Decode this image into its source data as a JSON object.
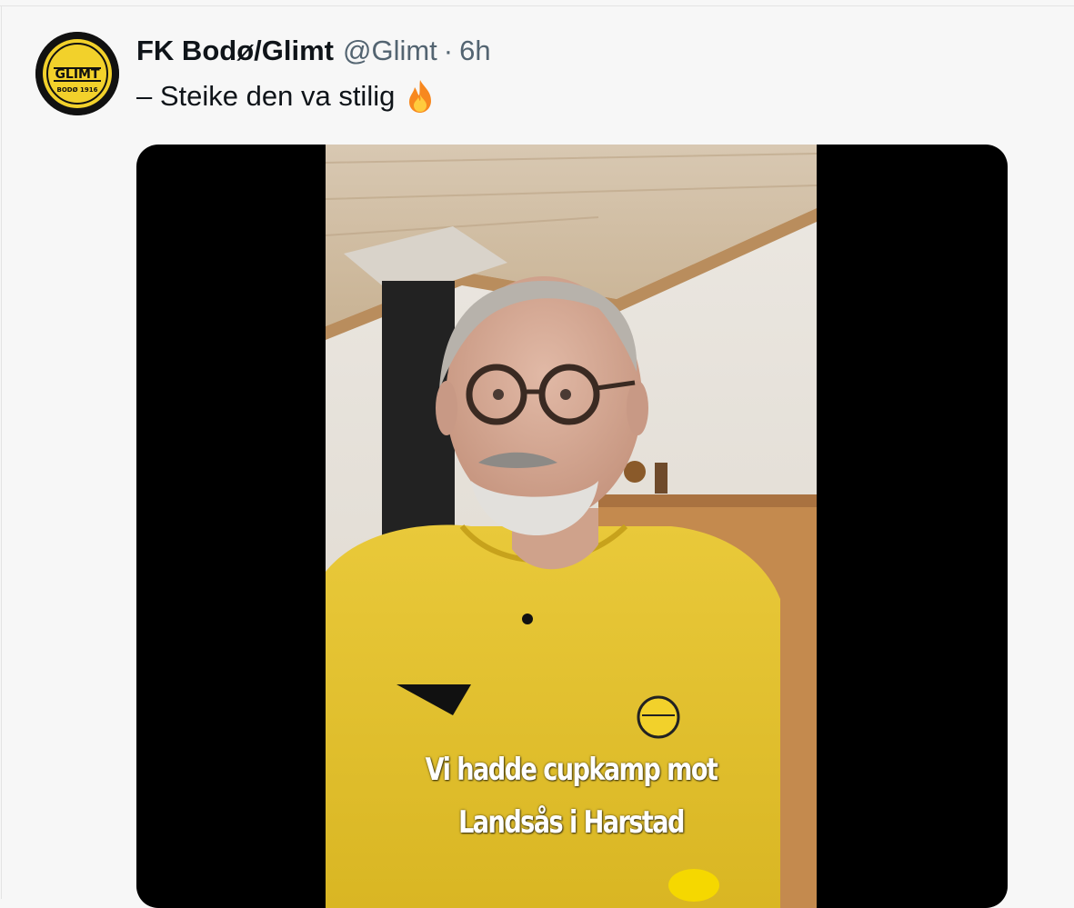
{
  "tweet": {
    "display_name": "FK Bodø/Glimt",
    "handle": "@Glimt",
    "separator": "·",
    "time": "6h",
    "text": "– Steike den va stilig",
    "emoji_icon": "fire-icon"
  },
  "avatar": {
    "logo_text_top": "GLIMT",
    "logo_text_bottom": "BODØ 1916"
  },
  "media": {
    "caption_line1": "Vi hadde cupkamp mot",
    "caption_line2": "Landsås i Harstad"
  },
  "colors": {
    "brand_yellow": "#f2d12b",
    "text_primary": "#0f1419",
    "text_secondary": "#536471"
  }
}
